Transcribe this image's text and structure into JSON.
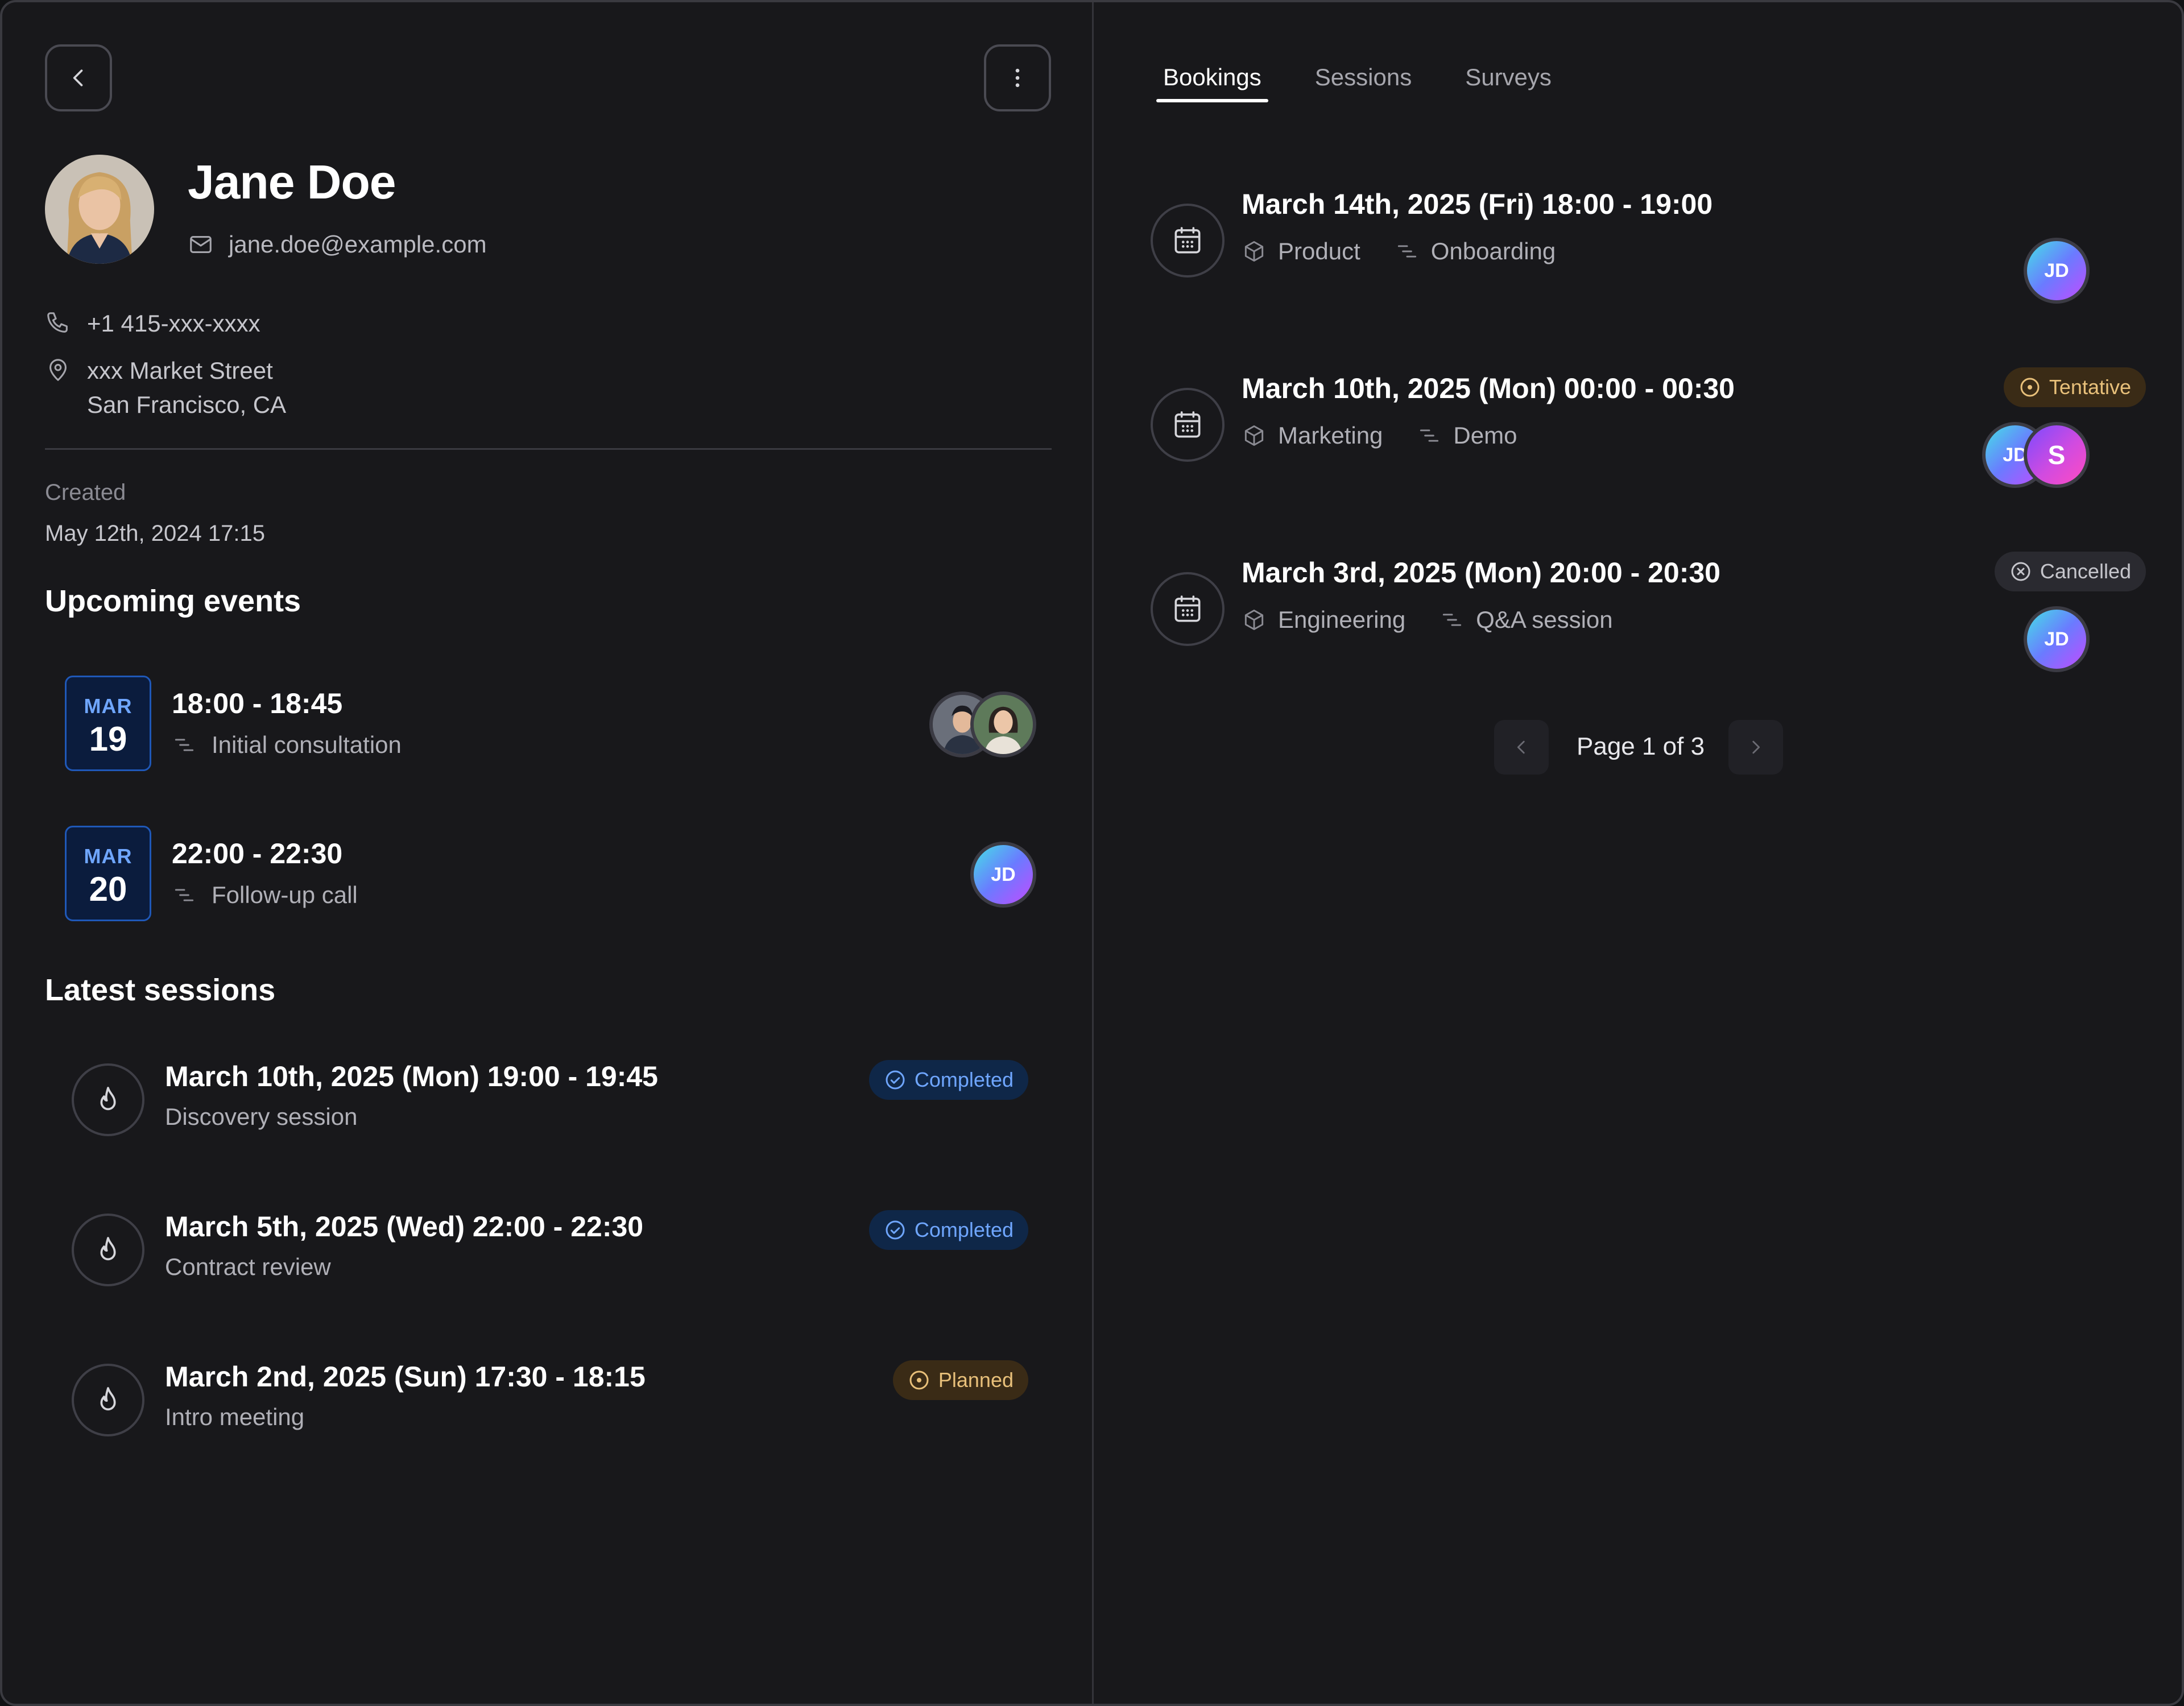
{
  "profile": {
    "name": "Jane Doe",
    "email": "jane.doe@example.com",
    "phone": "+1 415-xxx-xxxx",
    "address_line1": "xxx Market Street",
    "address_line2": "San Francisco, CA",
    "created_label": "Created",
    "created_value": "May 12th, 2024 17:15"
  },
  "upcoming": {
    "title": "Upcoming events",
    "events": [
      {
        "month": "MAR",
        "day": "19",
        "time": "18:00 - 18:45",
        "name": "Initial consultation"
      },
      {
        "month": "MAR",
        "day": "20",
        "time": "22:00 - 22:30",
        "name": "Follow-up call",
        "avatar": "JD"
      }
    ]
  },
  "sessions": {
    "title": "Latest sessions",
    "items": [
      {
        "title": "March 10th, 2025 (Mon) 19:00 - 19:45",
        "desc": "Discovery session",
        "status": "Completed"
      },
      {
        "title": "March 5th, 2025 (Wed) 22:00 - 22:30",
        "desc": "Contract review",
        "status": "Completed"
      },
      {
        "title": "March 2nd, 2025 (Sun) 17:30 - 18:15",
        "desc": "Intro meeting",
        "status": "Planned"
      }
    ]
  },
  "tabs": [
    "Bookings",
    "Sessions",
    "Surveys"
  ],
  "bookings": [
    {
      "title": "March 14th, 2025 (Fri) 18:00 - 19:00",
      "team": "Product",
      "type": "Onboarding",
      "avatars": [
        "JD"
      ]
    },
    {
      "title": "March 10th, 2025 (Mon) 00:00 - 00:30",
      "team": "Marketing",
      "type": "Demo",
      "status": "Tentative",
      "avatars": [
        "JD",
        "S"
      ]
    },
    {
      "title": "March 3rd, 2025 (Mon) 20:00 - 20:30",
      "team": "Engineering",
      "type": "Q&A session",
      "status": "Cancelled",
      "avatars": [
        "JD"
      ]
    }
  ],
  "pagination": {
    "label": "Page 1 of 3"
  },
  "colors": {
    "background": "#18181b",
    "accent_blue": "#6fa6ff",
    "planned_amber": "#e8c07a"
  }
}
